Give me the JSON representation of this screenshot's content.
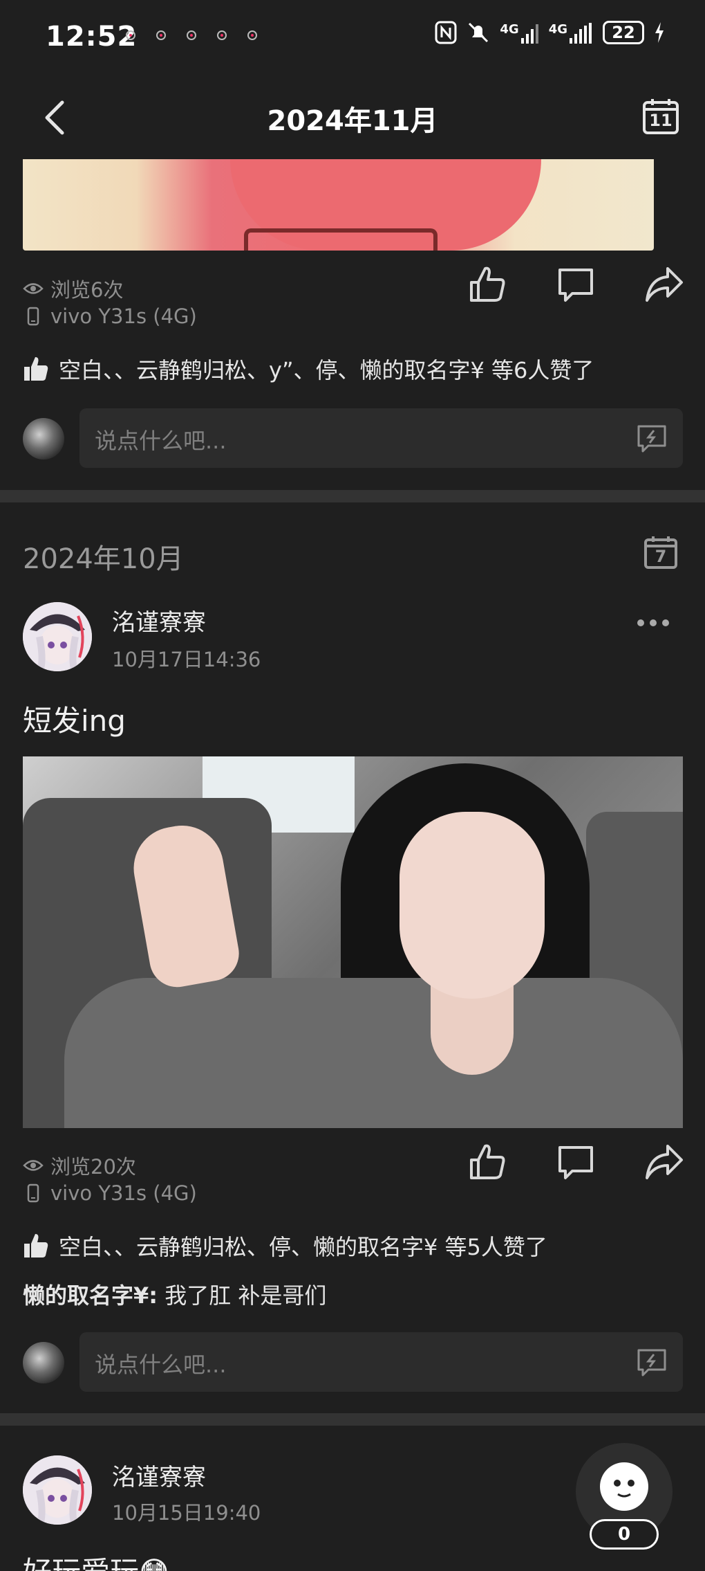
{
  "status_bar": {
    "time": "12:52",
    "battery": "22",
    "signal_1": "4G",
    "signal_2": "4G"
  },
  "header": {
    "title": "2024年11月",
    "calendar_day": "11"
  },
  "post_prev": {
    "views": "浏览6次",
    "device": "vivo Y31s (4G)",
    "likes": "空白、、云静鹤归松、y”、停、懒的取名字¥ 等6人赞了",
    "reply_placeholder": "说点什么吧..."
  },
  "month_section": {
    "label": "2024年10月",
    "calendar_day": "7"
  },
  "post_main": {
    "author": "洺谨寮寮",
    "time": "10月17日14:36",
    "text": "短发ing",
    "views": "浏览20次",
    "device": "vivo Y31s (4G)",
    "likes": "空白、、云静鹤归松、停、懒的取名字¥ 等5人赞了",
    "comment_author": "懒的取名字¥",
    "comment_text": " 我了肛 补是哥们",
    "reply_placeholder": "说点什么吧..."
  },
  "post_next": {
    "author": "洺谨寮寮",
    "time": "10月15日19:40",
    "text": "好玩爱玩😳"
  },
  "float_button": {
    "count": "0"
  }
}
